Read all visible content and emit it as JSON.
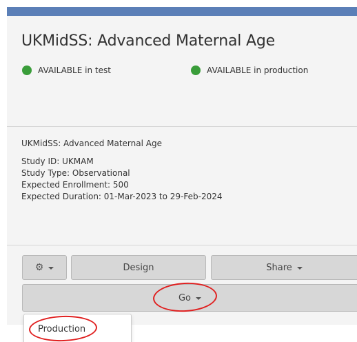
{
  "study": {
    "title": "UKMidSS: Advanced Maternal Age",
    "status_test": "AVAILABLE in test",
    "status_production": "AVAILABLE in production",
    "status_color": "#3a9d3a"
  },
  "details": {
    "name": "UKMidSS: Advanced Maternal Age",
    "study_id": "Study ID: UKMAM",
    "study_type": "Study Type: Observational",
    "enrollment": "Expected Enrollment: 500",
    "duration": "Expected Duration: 01-Mar-2023 to 29-Feb-2024"
  },
  "toolbar": {
    "gear_icon": "gear-icon",
    "design_label": "Design",
    "share_label": "Share",
    "go_label": "Go"
  },
  "go_menu": {
    "items": [
      "Production"
    ]
  },
  "colors": {
    "header_bar": "#5b7fb7",
    "annotation": "#e02020"
  }
}
